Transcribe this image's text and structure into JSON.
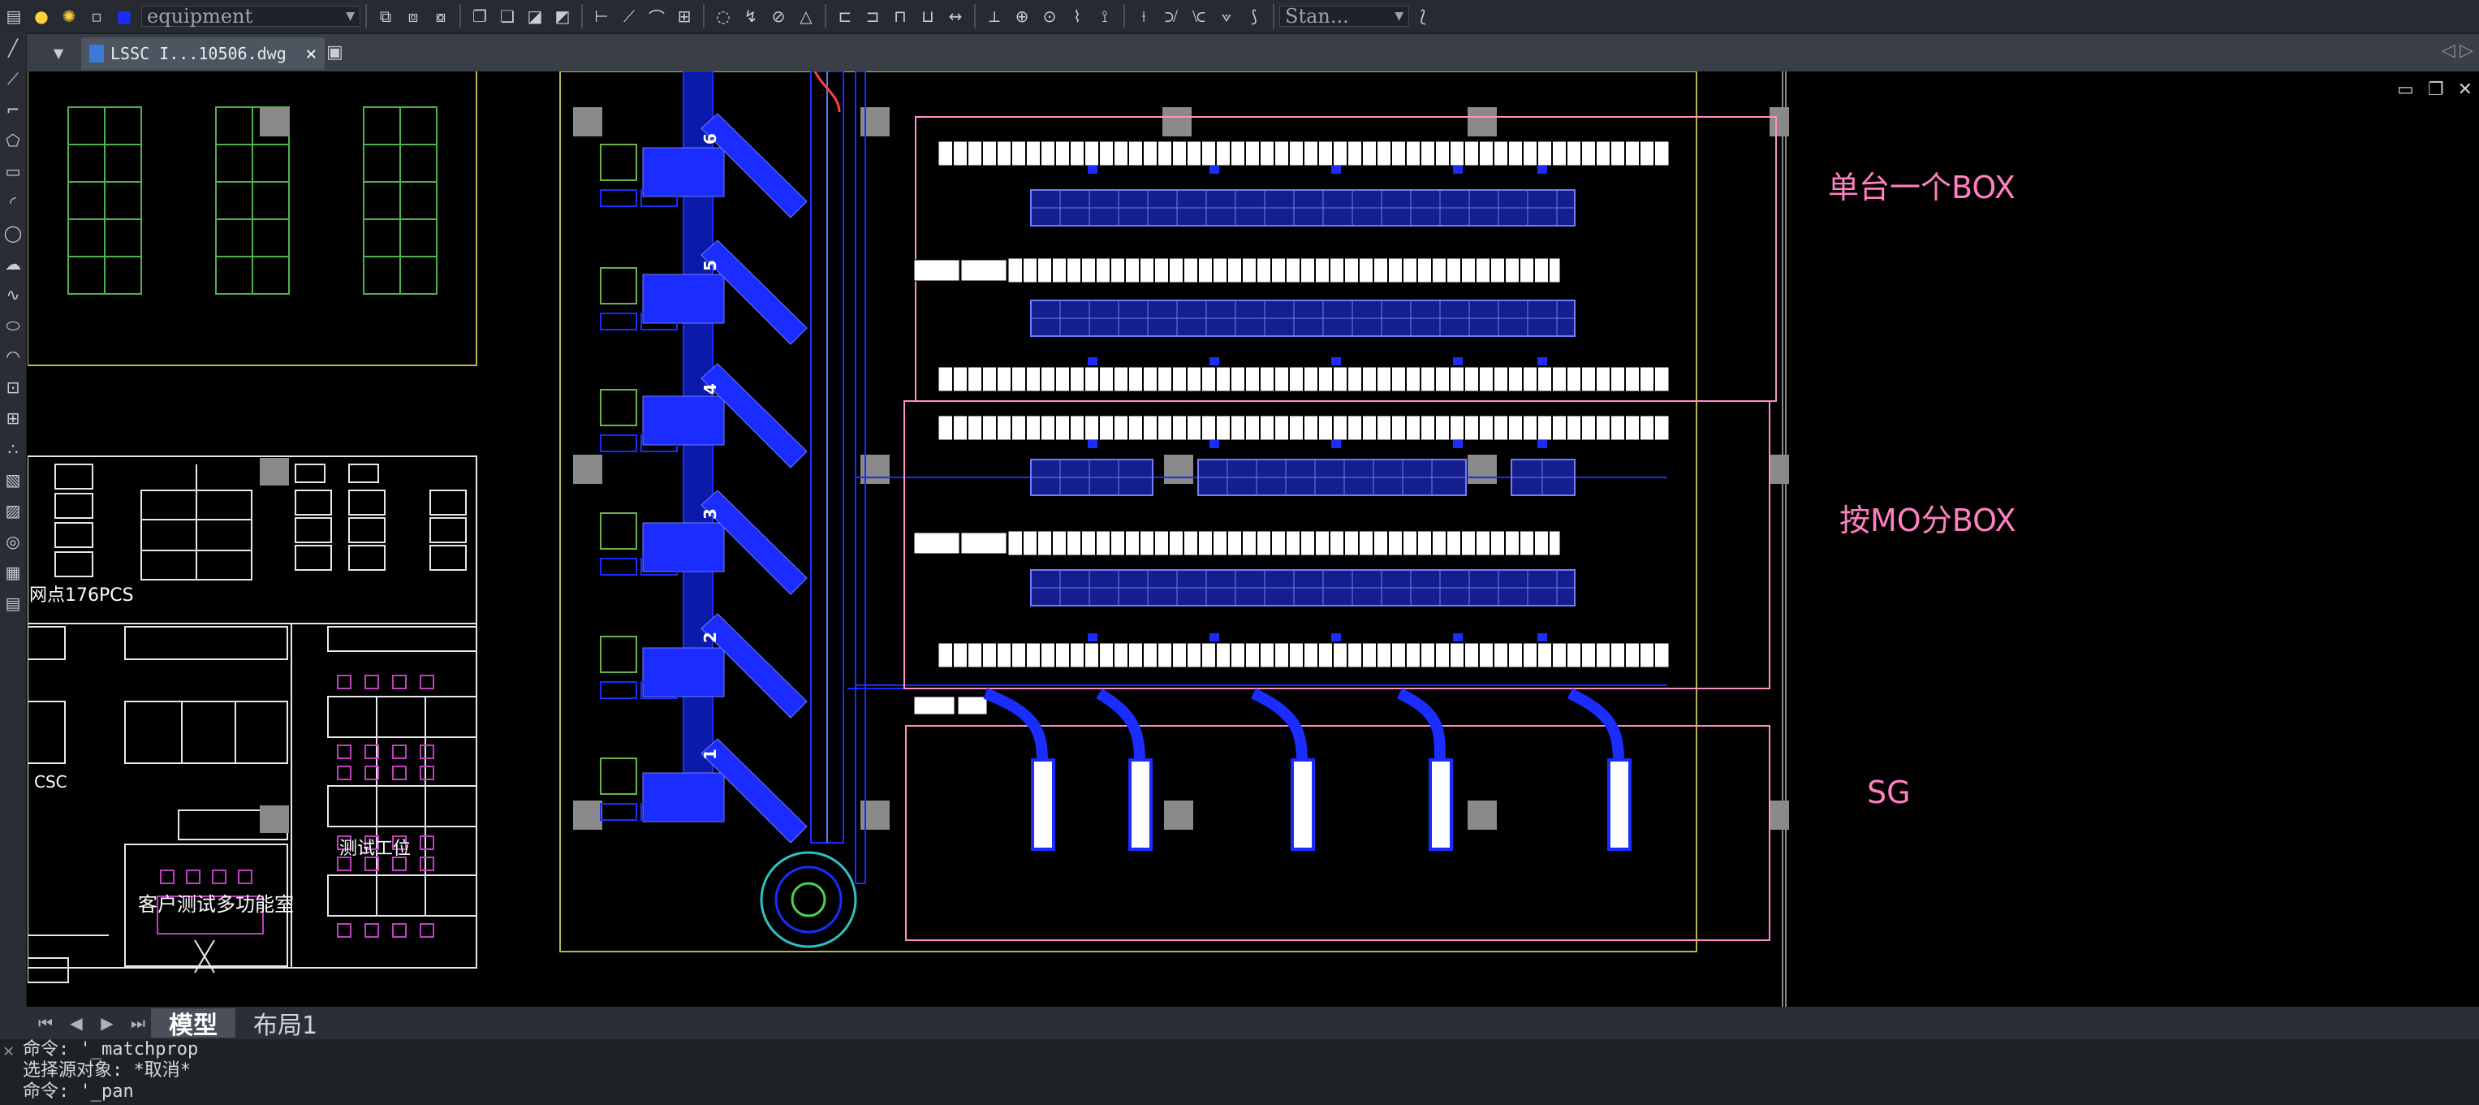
{
  "toolbar": {
    "layer_name": "equipment",
    "text_style": "Stan...",
    "icons": [
      "layer-bulb-icon",
      "layer-sun-icon",
      "layer-lock-icon",
      "layer-color-icon"
    ]
  },
  "tabs": {
    "document_tab": "LSSC I...10506.dwg"
  },
  "layout_tabs": {
    "model": "模型",
    "layout1": "布局1"
  },
  "command_line": {
    "line1": "命令: '_matchprop",
    "line2": "选择源对象: *取消*",
    "line3": "命令: '_pan"
  },
  "drawing": {
    "notes": {
      "single_box": "单台一个BOX",
      "mo_box": "按MO分BOX",
      "sg": "SG"
    },
    "labels": {
      "point_label": "网点176PCS",
      "csc": "CSC",
      "test_station": "测试工位",
      "customer_room": "客户测试多功能室"
    },
    "lane_numbers": [
      "6",
      "5",
      "4",
      "3",
      "2",
      "1"
    ]
  },
  "colors": {
    "accent_blue": "#1a2cff",
    "pink_outline": "#ff8fc8",
    "yellow_outline": "#b8b84a",
    "green_cells": "#4db34d",
    "magenta": "#c040c0"
  }
}
